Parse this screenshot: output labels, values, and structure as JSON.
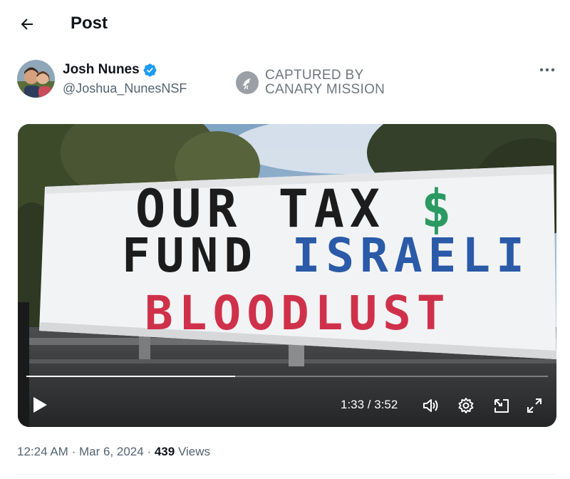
{
  "header": {
    "title": "Post"
  },
  "author": {
    "name": "Josh Nunes",
    "handle": "@Joshua_NunesNSF",
    "verified": true,
    "verified_color": "#1d9bf0"
  },
  "watermark": {
    "line1": "CAPTURED BY",
    "line2": "CANARY MISSION"
  },
  "icons": {
    "back": "arrow-left-icon",
    "more": "more-horizontal-icon",
    "play": "play-icon",
    "volume": "volume-icon",
    "settings": "gear-icon",
    "pip": "picture-in-picture-icon",
    "fullscreen": "fullscreen-icon"
  },
  "video": {
    "banner": {
      "line1_a": "OUR TAX ",
      "line1_b": "$",
      "line2_a": "FUND ",
      "line2_b": "ISRAELI",
      "line3": "BLOODLUST"
    },
    "current_time": "1:33",
    "duration": "3:52",
    "time_display": "1:33 / 3:52",
    "progress_percent": 40
  },
  "meta": {
    "time": "12:24 AM",
    "separator": "·",
    "date": "Mar 6, 2024",
    "views_count": "439",
    "views_label": "Views"
  }
}
